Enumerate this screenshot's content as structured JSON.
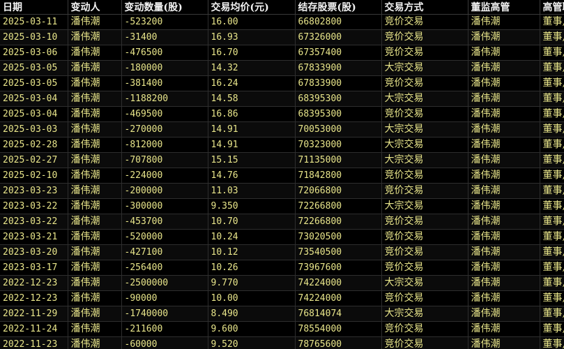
{
  "columns": [
    "日期",
    "变动人",
    "变动数量(股)",
    "交易均价(元)",
    "结存股票(股)",
    "交易方式",
    "董监高管",
    "高管职务"
  ],
  "rows": [
    [
      "2025-03-11",
      "潘伟潮",
      "-523200",
      "16.00",
      "66802800",
      "竞价交易",
      "潘伟潮",
      "董事,"
    ],
    [
      "2025-03-10",
      "潘伟潮",
      "-31400",
      "16.93",
      "67326000",
      "竞价交易",
      "潘伟潮",
      "董事,"
    ],
    [
      "2025-03-06",
      "潘伟潮",
      "-476500",
      "16.70",
      "67357400",
      "竞价交易",
      "潘伟潮",
      "董事,"
    ],
    [
      "2025-03-05",
      "潘伟潮",
      "-180000",
      "14.32",
      "67833900",
      "大宗交易",
      "潘伟潮",
      "董事,"
    ],
    [
      "2025-03-05",
      "潘伟潮",
      "-381400",
      "16.24",
      "67833900",
      "竞价交易",
      "潘伟潮",
      "董事,"
    ],
    [
      "2025-03-04",
      "潘伟潮",
      "-1188200",
      "14.58",
      "68395300",
      "大宗交易",
      "潘伟潮",
      "董事,"
    ],
    [
      "2025-03-04",
      "潘伟潮",
      "-469500",
      "16.86",
      "68395300",
      "竞价交易",
      "潘伟潮",
      "董事,"
    ],
    [
      "2025-03-03",
      "潘伟潮",
      "-270000",
      "14.91",
      "70053000",
      "大宗交易",
      "潘伟潮",
      "董事,"
    ],
    [
      "2025-02-28",
      "潘伟潮",
      "-812000",
      "14.91",
      "70323000",
      "大宗交易",
      "潘伟潮",
      "董事,"
    ],
    [
      "2025-02-27",
      "潘伟潮",
      "-707800",
      "15.15",
      "71135000",
      "大宗交易",
      "潘伟潮",
      "董事,"
    ],
    [
      "2025-02-10",
      "潘伟潮",
      "-224000",
      "14.76",
      "71842800",
      "竞价交易",
      "潘伟潮",
      "董事,"
    ],
    [
      "2023-03-23",
      "潘伟潮",
      "-200000",
      "11.03",
      "72066800",
      "竞价交易",
      "潘伟潮",
      "董事,"
    ],
    [
      "2023-03-22",
      "潘伟潮",
      "-300000",
      "9.350",
      "72266800",
      "大宗交易",
      "潘伟潮",
      "董事,"
    ],
    [
      "2023-03-22",
      "潘伟潮",
      "-453700",
      "10.70",
      "72266800",
      "竞价交易",
      "潘伟潮",
      "董事,"
    ],
    [
      "2023-03-21",
      "潘伟潮",
      "-520000",
      "10.24",
      "73020500",
      "竞价交易",
      "潘伟潮",
      "董事,"
    ],
    [
      "2023-03-20",
      "潘伟潮",
      "-427100",
      "10.12",
      "73540500",
      "竞价交易",
      "潘伟潮",
      "董事,"
    ],
    [
      "2023-03-17",
      "潘伟潮",
      "-256400",
      "10.26",
      "73967600",
      "竞价交易",
      "潘伟潮",
      "董事,"
    ],
    [
      "2022-12-23",
      "潘伟潮",
      "-2500000",
      "9.770",
      "74224000",
      "大宗交易",
      "潘伟潮",
      "董事,"
    ],
    [
      "2022-12-23",
      "潘伟潮",
      "-90000",
      "10.00",
      "74224000",
      "竞价交易",
      "潘伟潮",
      "董事,"
    ],
    [
      "2022-11-29",
      "潘伟潮",
      "-1740000",
      "8.490",
      "76814074",
      "大宗交易",
      "潘伟潮",
      "董事,"
    ],
    [
      "2022-11-24",
      "潘伟潮",
      "-211600",
      "9.600",
      "78554000",
      "竞价交易",
      "潘伟潮",
      "董事,"
    ],
    [
      "2022-11-23",
      "潘伟潮",
      "-60000",
      "9.520",
      "78765600",
      "竞价交易",
      "潘伟潮",
      "董事,"
    ]
  ],
  "colors": {
    "background": "#000000",
    "header_text": "#f2f2f2",
    "cell_text": "#e8e58a",
    "grid_line": "#2e2e2e"
  }
}
